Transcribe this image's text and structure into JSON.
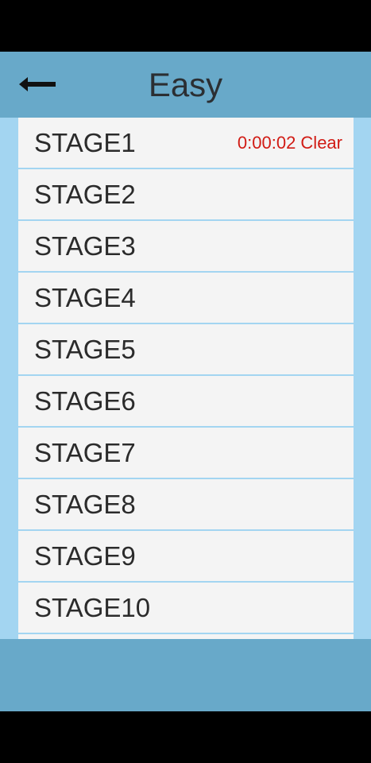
{
  "header": {
    "title": "Easy",
    "back_icon": "left-arrow-icon"
  },
  "stages": [
    {
      "label": "STAGE1",
      "status": "0:00:02 Clear"
    },
    {
      "label": "STAGE2",
      "status": ""
    },
    {
      "label": "STAGE3",
      "status": ""
    },
    {
      "label": "STAGE4",
      "status": ""
    },
    {
      "label": "STAGE5",
      "status": ""
    },
    {
      "label": "STAGE6",
      "status": ""
    },
    {
      "label": "STAGE7",
      "status": ""
    },
    {
      "label": "STAGE8",
      "status": ""
    },
    {
      "label": "STAGE9",
      "status": ""
    },
    {
      "label": "STAGE10",
      "status": ""
    },
    {
      "label": "",
      "status": ""
    }
  ],
  "colors": {
    "header_bg": "#68a9c9",
    "list_bg": "#a3d5f1",
    "item_bg": "#f4f4f4",
    "clear_text": "#d11b14"
  }
}
